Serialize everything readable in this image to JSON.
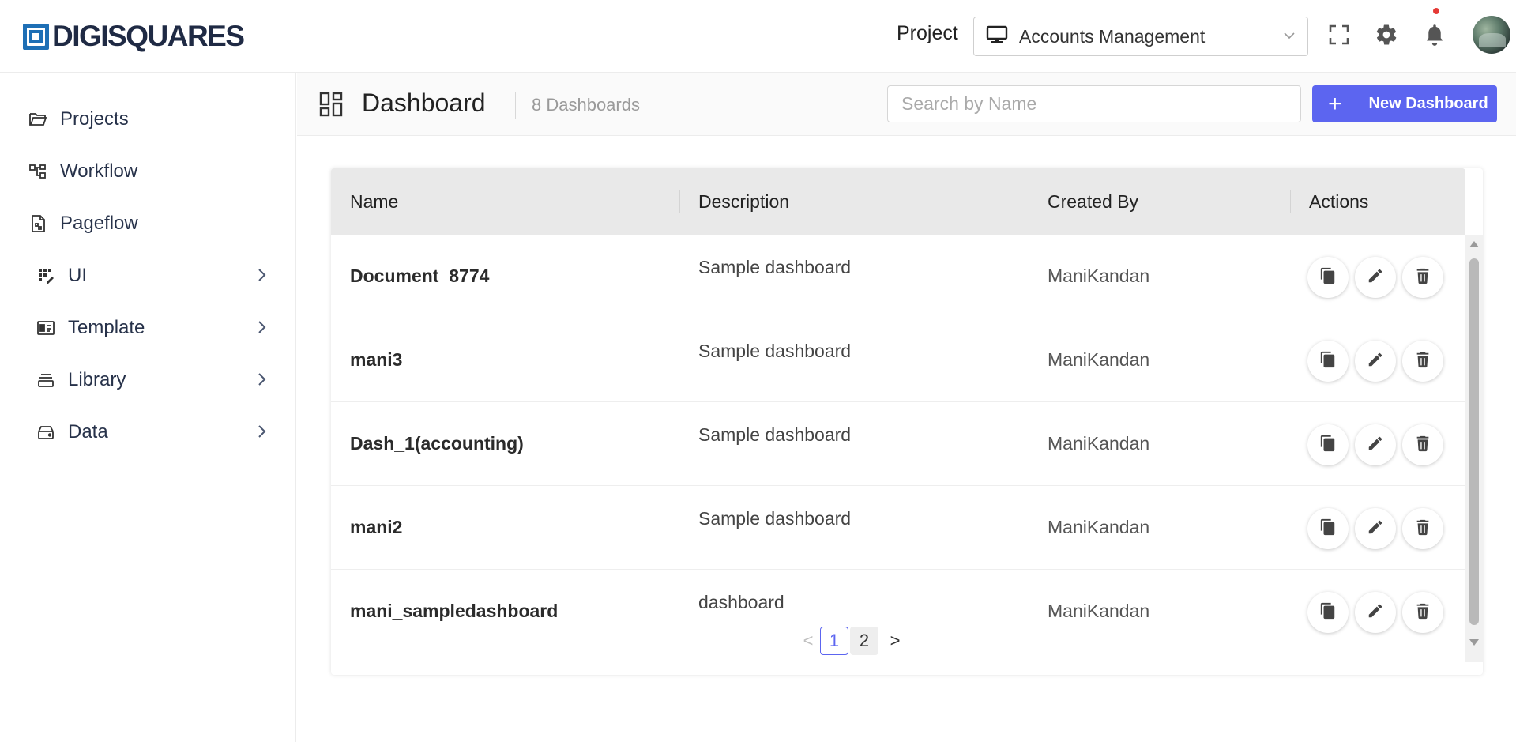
{
  "header": {
    "logo_text": "DIGISQUARES",
    "project_label": "Project",
    "project_selected": "Accounts Management"
  },
  "sidebar": {
    "items": [
      {
        "label": "Projects",
        "icon": "folder-icon"
      },
      {
        "label": "Workflow",
        "icon": "workflow-icon"
      },
      {
        "label": "Pageflow",
        "icon": "pageflow-icon"
      },
      {
        "label": "UI",
        "icon": "ui-grid-icon"
      },
      {
        "label": "Template",
        "icon": "template-icon"
      },
      {
        "label": "Library",
        "icon": "library-icon"
      },
      {
        "label": "Data",
        "icon": "data-drive-icon"
      }
    ]
  },
  "toolbar": {
    "title": "Dashboard",
    "count": "8 Dashboards",
    "search_placeholder": "Search by Name",
    "search_value": "",
    "new_button": "New Dashboard"
  },
  "table": {
    "columns": [
      "Name",
      "Description",
      "Created By",
      "Actions"
    ],
    "rows": [
      {
        "name": "Document_8774",
        "description": "Sample dashboard",
        "created_by": "ManiKandan"
      },
      {
        "name": "mani3",
        "description": "Sample dashboard",
        "created_by": "ManiKandan"
      },
      {
        "name": "Dash_1(accounting)",
        "description": "Sample dashboard",
        "created_by": "ManiKandan"
      },
      {
        "name": "mani2",
        "description": "Sample dashboard",
        "created_by": "ManiKandan"
      },
      {
        "name": "mani_sampledashboard",
        "description": "dashboard",
        "created_by": "ManiKandan"
      }
    ]
  },
  "pagination": {
    "pages": [
      "1",
      "2"
    ],
    "current": "1",
    "prev": "<",
    "next": ">"
  },
  "colors": {
    "accent": "#5c65f0",
    "brand": "#1e6fb5",
    "notification_dot": "#e53935"
  }
}
